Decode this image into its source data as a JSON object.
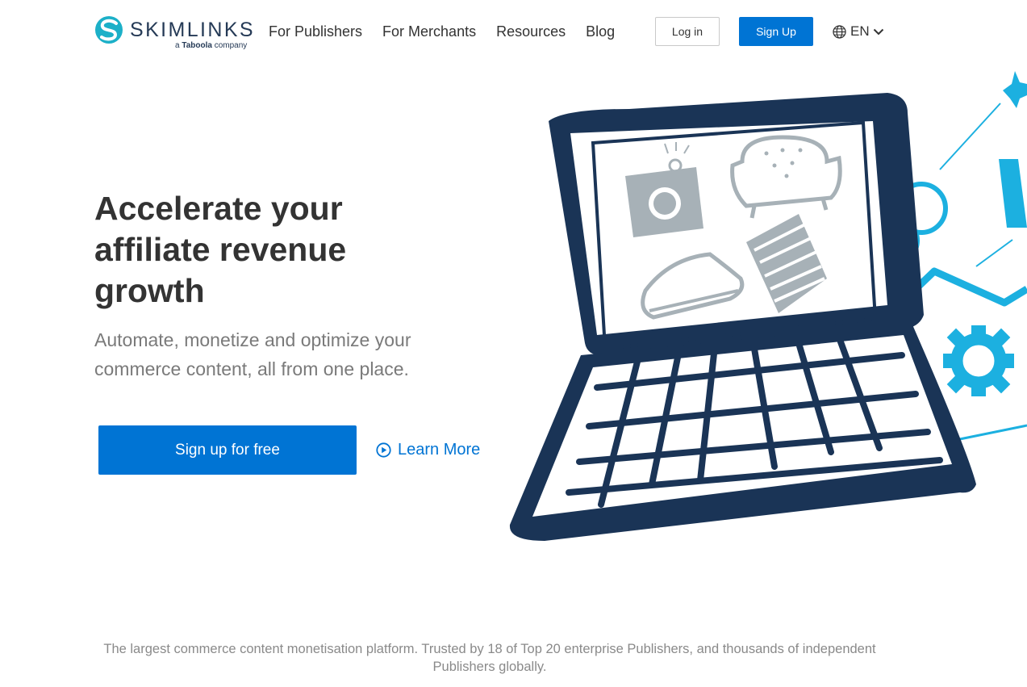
{
  "brand": {
    "name": "SKIMLINKS",
    "tagline_prefix": "a",
    "tagline_brand": "Taboola",
    "tagline_suffix": "company"
  },
  "nav": {
    "items": [
      {
        "label": "For Publishers"
      },
      {
        "label": "For Merchants"
      },
      {
        "label": "Resources"
      },
      {
        "label": "Blog"
      }
    ],
    "login_label": "Log in",
    "signup_label": "Sign Up",
    "language_label": "EN"
  },
  "hero": {
    "title": "Accelerate your affiliate revenue growth",
    "subtitle": "Automate, monetize and optimize your commerce content, all from one place.",
    "cta_label": "Sign up for free",
    "learn_more_label": "Learn More"
  },
  "footer": {
    "trust_text": "The largest commerce content monetisation platform. Trusted by 18 of Top 20 enterprise Publishers, and thousands of independent Publishers globally."
  },
  "colors": {
    "accent": "#0074d4",
    "navy": "#1a3456",
    "cyan": "#1cb0e0",
    "gray": "#a7b1b7"
  },
  "icons": {
    "language": "globe-icon",
    "dropdown": "chevron-down-icon",
    "learn_more": "play-circle-icon"
  }
}
